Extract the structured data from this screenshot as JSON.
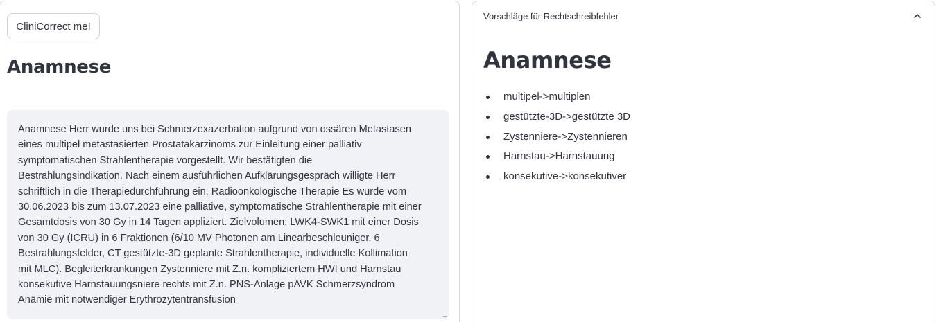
{
  "left": {
    "button_label": "CliniCorrect me!",
    "title": "Anamnese",
    "text": "Anamnese Herr wurde uns bei Schmerzexazerbation aufgrund von ossären Metastasen\neines multipel metastasierten Prostatakarzinoms zur Einleitung einer palliativ\nsymptomatischen Strahlentherapie vorgestellt. Wir bestätigten die\nBestrahlungsindikation. Nach einem ausführlichen Aufklärungsgespräch willigte Herr\nschriftlich in die Therapiedurchführung ein. Radioonkologische Therapie Es wurde vom\n30.06.2023 bis zum 13.07.2023 eine palliative, symptomatische Strahlentherapie mit einer\nGesamtdosis von 30 Gy in 14 Tagen appliziert. Zielvolumen: LWK4-SWK1 mit einer Dosis\nvon 30 Gy (ICRU) in 6 Fraktionen (6/10 MV Photonen am Linearbeschleuniger, 6\nBestrahlungsfelder, CT gestützte-3D geplante Strahlentherapie, individuelle Kollimation\nmit MLC). Begleiterkrankungen Zystenniere mit Z.n. kompliziertem HWI und Harnstau\nkonsekutive Harnstauungsniere rechts mit Z.n. PNS-Anlage pAVK Schmerzsyndrom\nAnämie mit notwendiger Erythrozytentransfusion"
  },
  "right": {
    "expander_label": "Vorschläge für Rechtschreibfehler",
    "title": "Anamnese",
    "suggestions": [
      "multipel->multiplen",
      "gestützte-3D->gestützte 3D",
      "Zystenniere->Zystennieren",
      "Harnstau->Harnstauung",
      "konsekutive->konsekutiver"
    ]
  },
  "icons": {
    "expander_toggle": "chevron-up-icon"
  }
}
